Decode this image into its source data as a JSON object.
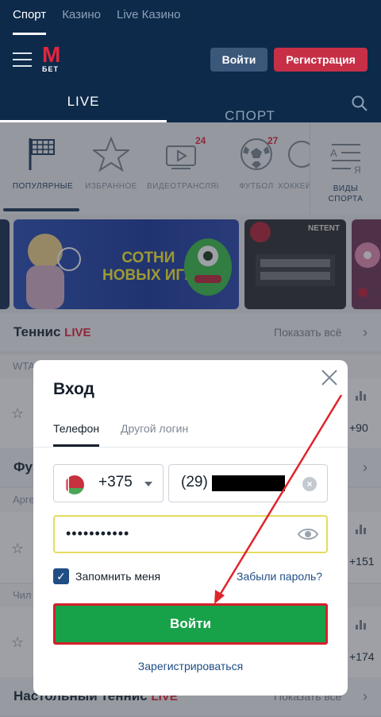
{
  "top_tabs": [
    "Спорт",
    "Казино",
    "Live Казино"
  ],
  "header": {
    "logo_letter": "M",
    "logo_sub": "БЕТ",
    "login_label": "Войти",
    "register_label": "Регистрация"
  },
  "mode_tabs": {
    "live": "LIVE",
    "sport": "СПОРТ"
  },
  "sports": [
    {
      "label": "ПОПУЛЯРНЫЕ"
    },
    {
      "label": "ИЗБРАННОЕ"
    },
    {
      "label": "ВИДЕОТРАНСЛЯЦИИ",
      "badge": "24"
    },
    {
      "label": "ФУТБОЛ",
      "badge": "27"
    },
    {
      "label": "ХОККЕЙ"
    }
  ],
  "kinds_label_1": "ВИДЫ",
  "kinds_label_2": "СПОРТА",
  "banners": {
    "games_line1": "СОТНИ",
    "games_line2": "НОВЫХ ИГР",
    "provider": "NETENT"
  },
  "sections": {
    "tennis": {
      "name": "Теннис",
      "live": "LIVE",
      "show_all": "Показать всё",
      "sub": "WTA",
      "odds": "+90"
    },
    "football": {
      "name": "Фу",
      "sub": "Арге",
      "odds": "+151"
    },
    "chile": {
      "sub": "Чил",
      "odds": "+174"
    },
    "table_tennis": {
      "name": "Настольный теннис",
      "live": "LIVE",
      "show_all": "Показать всё"
    }
  },
  "modal": {
    "title": "Вход",
    "tab_phone": "Телефон",
    "tab_other": "Другой логин",
    "country_code": "+375",
    "phone_prefix": "(29)",
    "password_masked": "•••••••••••",
    "remember_label": "Запомнить меня",
    "forgot_label": "Забыли пароль?",
    "submit_label": "Войти",
    "register_label": "Зарегистрироваться"
  },
  "colors": {
    "brand_navy": "#0d2a4a",
    "brand_red": "#e3263c",
    "submit_green": "#17a24a",
    "link_blue": "#1f4e85"
  }
}
